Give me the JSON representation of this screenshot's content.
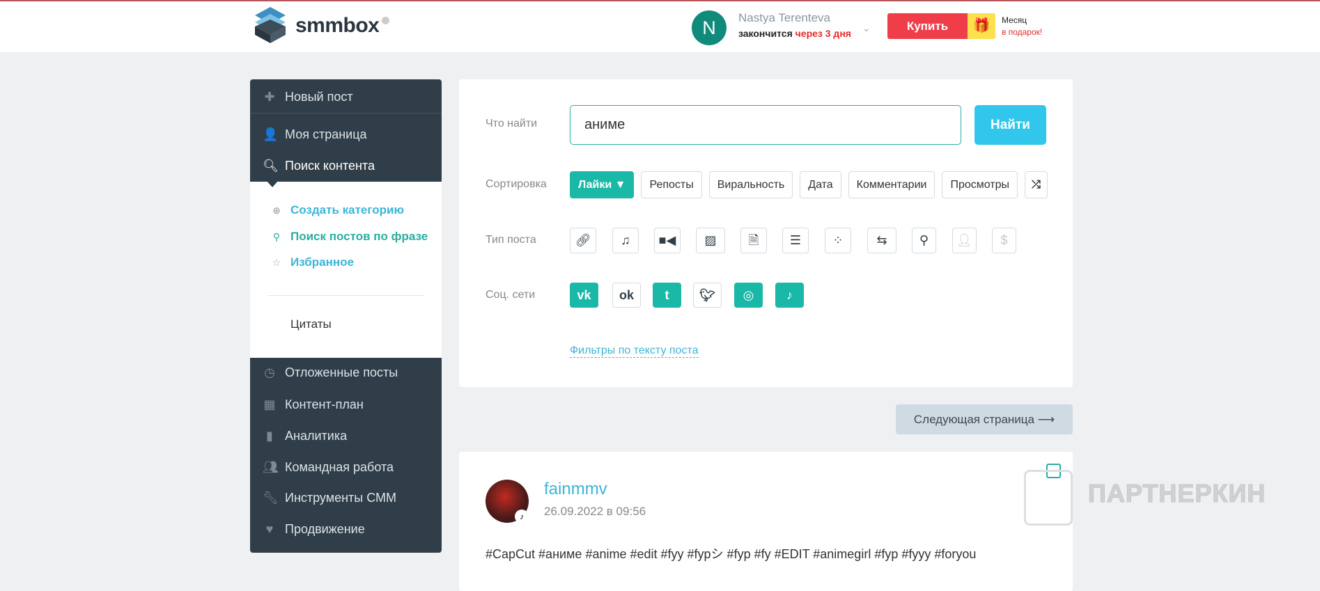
{
  "header": {
    "logo": "smmbox",
    "user_initial": "N",
    "user_name": "Nastya Terenteva",
    "expires_prefix": "закончится",
    "expires_value": "через 3 дня",
    "buy_label": "Купить",
    "gift_line1": "Месяц",
    "gift_line2": "в подарок!"
  },
  "sidebar": {
    "items_top": [
      {
        "label": "Новый пост",
        "icon": "plus-icon"
      },
      {
        "label": "Моя страница",
        "icon": "user-icon"
      },
      {
        "label": "Поиск контента",
        "icon": "search-icon"
      }
    ],
    "sub_items": [
      {
        "label": "Создать категорию",
        "icon": "plus-circle-icon"
      },
      {
        "label": "Поиск постов по фразе",
        "icon": "search-icon"
      },
      {
        "label": "Избранное",
        "icon": "star-icon"
      }
    ],
    "category": "Цитаты",
    "items_bottom": [
      {
        "label": "Отложенные посты",
        "icon": "clock-icon"
      },
      {
        "label": "Контент-план",
        "icon": "calendar-icon"
      },
      {
        "label": "Аналитика",
        "icon": "bar-chart-icon"
      },
      {
        "label": "Командная работа",
        "icon": "users-icon"
      },
      {
        "label": "Инструменты СММ",
        "icon": "wrench-icon"
      },
      {
        "label": "Продвижение",
        "icon": "heart-icon"
      }
    ]
  },
  "search": {
    "label": "Что найти",
    "value": "аниме",
    "button": "Найти",
    "sort_label": "Сортировка",
    "sort": [
      "Лайки ▼",
      "Репосты",
      "Виральность",
      "Дата",
      "Комментарии",
      "Просмотры"
    ],
    "type_label": "Тип поста",
    "social_label": "Соц. сети",
    "filters_link": "Фильтры по тексту поста"
  },
  "next_page": "Следующая страница ⟶",
  "post": {
    "author": "fainmmv",
    "date": "26.09.2022 в 09:56",
    "text": "#CapCut #аниме #anime #edit #fyy #fypシ #fyp #fy #EDIT #animegirl #fyp #fyyy #foryou"
  },
  "watermark": "ПАРТНЕРКИН",
  "colors": {
    "accent": "#1ab8a6",
    "link": "#3bb5d8",
    "sidebar": "#2f3e48",
    "buy": "#ef3e4a",
    "find": "#31c6ec"
  }
}
